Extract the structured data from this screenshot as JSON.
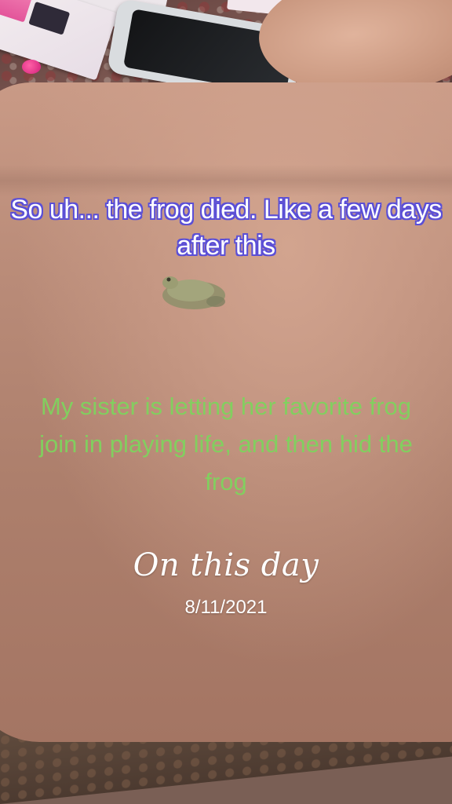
{
  "overlay": {
    "top_caption": "So uh... the frog died. Like a few days after this",
    "middle_caption": "My sister is letting her favorite frog join in playing life, and then hid the frog",
    "memory_title": "On this day",
    "memory_date": "8/11/2021"
  },
  "colors": {
    "top_caption_outline": "#5b4fd6",
    "middle_caption_text": "#7fd35e",
    "memory_text": "#ffffff"
  },
  "scene": {
    "subjects": [
      "frog-icon",
      "phone-icon",
      "hand",
      "arm"
    ]
  }
}
